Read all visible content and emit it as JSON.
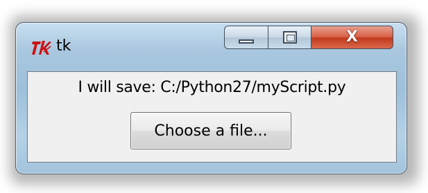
{
  "window": {
    "title": "tk",
    "icon": "tk-feather-icon",
    "caption_buttons": {
      "minimize": "minimize-icon",
      "maximize": "maximize-icon",
      "close_label": "X"
    }
  },
  "content": {
    "save_text": "I will save: C:/Python27/myScript.py",
    "choose_button_label": "Choose a file..."
  },
  "colors": {
    "close_button": "#c23a1d",
    "frame": "#a9c7df",
    "client_bg": "#f0f0f0",
    "tk_logo": "#cc1111"
  }
}
